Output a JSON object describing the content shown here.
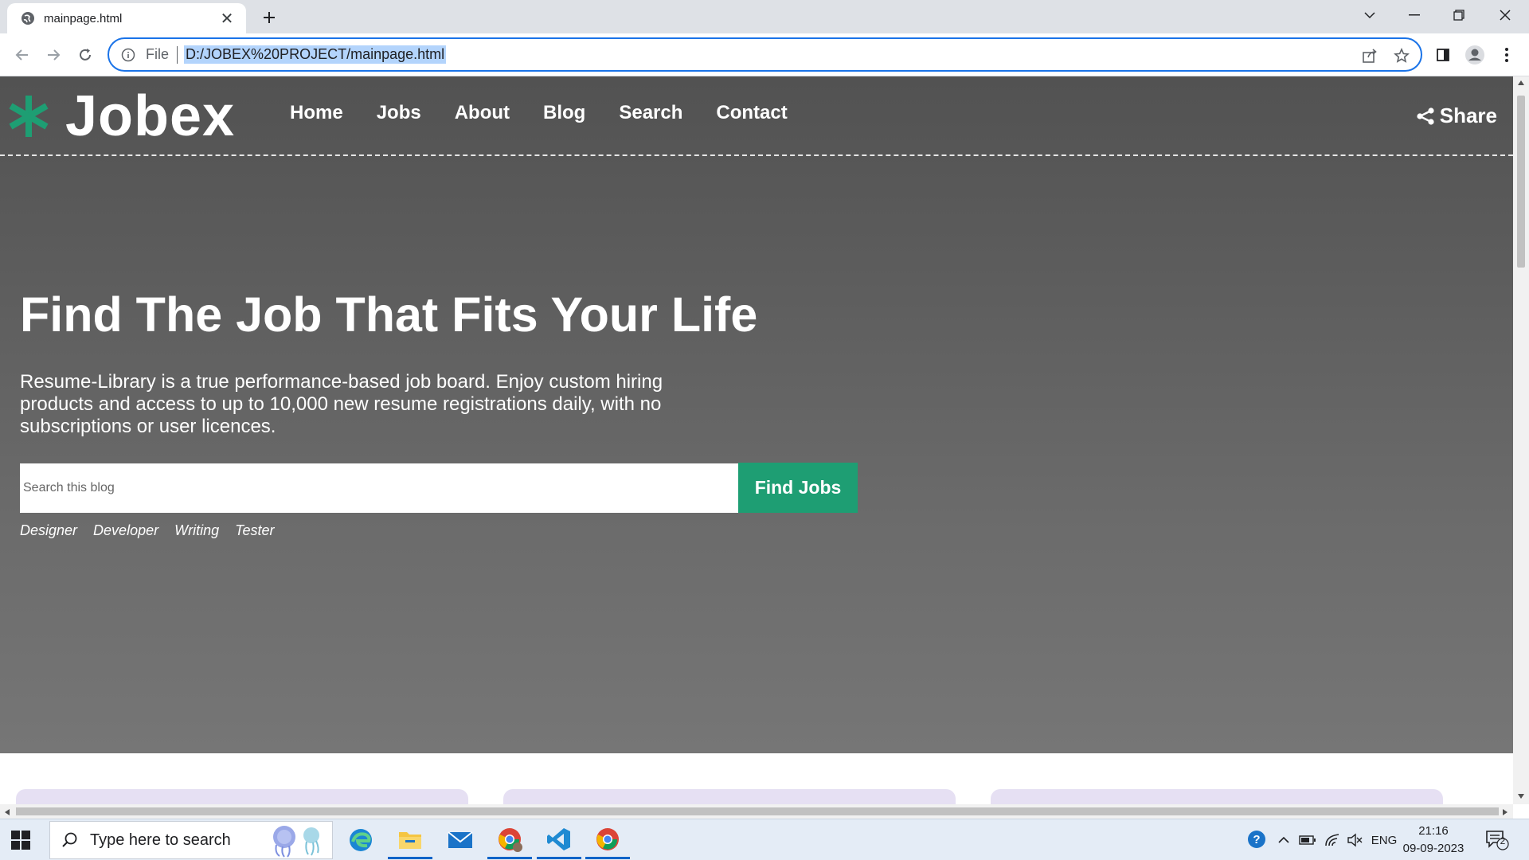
{
  "browser": {
    "tab_title": "mainpage.html",
    "omnibox_prefix": "File",
    "url": "D:/JOBEX%20PROJECT/mainpage.html"
  },
  "site": {
    "logo_text": "Jobex",
    "nav": [
      "Home",
      "Jobs",
      "About",
      "Blog",
      "Search",
      "Contact"
    ],
    "share_label": "Share",
    "hero_title": "Find The Job That Fits Your Life",
    "hero_description": "Resume-Library is a true performance-based job board. Enjoy custom hiring products and access to up to 10,000 new resume registrations daily, with no subscriptions or user licences.",
    "search_placeholder": "Search this blog",
    "find_button": "Find Jobs",
    "tags": [
      "Designer",
      "Developer",
      "Writing",
      "Tester"
    ],
    "accent_color": "#1e9e73"
  },
  "taskbar": {
    "search_placeholder": "Type here to search",
    "language": "ENG",
    "time": "21:16",
    "date": "09-09-2023",
    "notification_count": "2"
  }
}
